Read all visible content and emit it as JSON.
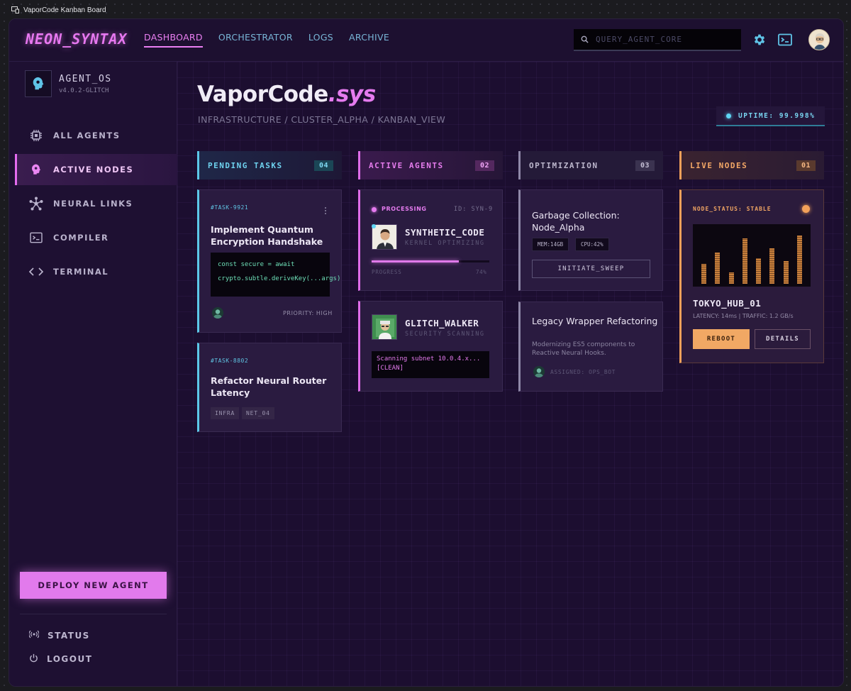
{
  "window": {
    "caption": "VaporCode Kanban Board"
  },
  "header": {
    "logo": "NEON_SYNTAX",
    "nav": [
      {
        "label": "DASHBOARD",
        "active": true
      },
      {
        "label": "ORCHESTRATOR",
        "active": false
      },
      {
        "label": "LOGS",
        "active": false
      },
      {
        "label": "ARCHIVE",
        "active": false
      }
    ],
    "search_placeholder": "QUERY_AGENT_CORE",
    "icons": [
      "search-icon",
      "gear-icon",
      "terminal-icon",
      "user-avatar"
    ]
  },
  "sidebar": {
    "os_title": "AGENT_OS",
    "os_version": "v4.0.2-GLITCH",
    "items": [
      {
        "label": "ALL AGENTS",
        "icon": "chip-icon",
        "active": false
      },
      {
        "label": "ACTIVE NODES",
        "icon": "brain-icon",
        "active": true
      },
      {
        "label": "NEURAL LINKS",
        "icon": "network-icon",
        "active": false
      },
      {
        "label": "COMPILER",
        "icon": "terminal-icon",
        "active": false
      },
      {
        "label": "TERMINAL",
        "icon": "code-icon",
        "active": false
      }
    ],
    "deploy_label": "DEPLOY NEW AGENT",
    "footer": [
      {
        "label": "STATUS",
        "icon": "signal-icon"
      },
      {
        "label": "LOGOUT",
        "icon": "power-icon"
      }
    ]
  },
  "main": {
    "title": "VaporCode",
    "title_ext": ".sys",
    "breadcrumb": "INFRASTRUCTURE / CLUSTER_ALPHA / KANBAN_VIEW",
    "uptime": "UPTIME: 99.998%"
  },
  "columns": [
    {
      "title": "PENDING TASKS",
      "count": "04"
    },
    {
      "title": "ACTIVE AGENTS",
      "count": "02"
    },
    {
      "title": "OPTIMIZATION",
      "count": "03"
    },
    {
      "title": "LIVE NODES",
      "count": "01"
    }
  ],
  "pending": [
    {
      "id": "#TASK-9921",
      "title": "Implement Quantum Encryption Handshake",
      "code_line1": "const secure = await",
      "code_line2": "crypto.subtle.deriveKey(...args)",
      "priority": "PRIORITY: HIGH"
    },
    {
      "id": "#TASK-8802",
      "title": "Refactor Neural Router Latency",
      "tags": [
        "INFRA",
        "NET_04"
      ]
    }
  ],
  "active": [
    {
      "status": "PROCESSING",
      "agent_id": "ID: SYN-9",
      "name": "SYNTHETIC_CODE",
      "sub": "KERNEL OPTIMIZING",
      "progress_label": "PROGRESS",
      "progress_value": "74%",
      "progress_fraction": 0.74
    },
    {
      "name": "GLITCH_WALKER",
      "sub": "SECURITY SCANNING",
      "log_line1": "Scanning subnet 10.0.4.x...",
      "log_line2": "[CLEAN]"
    }
  ],
  "optimization": [
    {
      "title": "Garbage Collection: Node_Alpha",
      "chips": [
        "MEM:14GB",
        "CPU:42%"
      ],
      "button": "INITIATE_SWEEP"
    },
    {
      "title": "Legacy Wrapper Refactoring",
      "desc": "Modernizing ES5 components to Reactive Neural Hooks.",
      "assigned": "ASSIGNED: OPS_BOT"
    }
  ],
  "live": {
    "status": "NODE_STATUS: STABLE",
    "bars": [
      0.35,
      0.55,
      0.2,
      0.8,
      0.45,
      0.62,
      0.4,
      0.85
    ],
    "name": "TOKYO_HUB_01",
    "stats": "LATENCY: 14ms | TRAFFIC: 1.2 GB/s",
    "reboot": "REBOOT",
    "details": "DETAILS"
  }
}
